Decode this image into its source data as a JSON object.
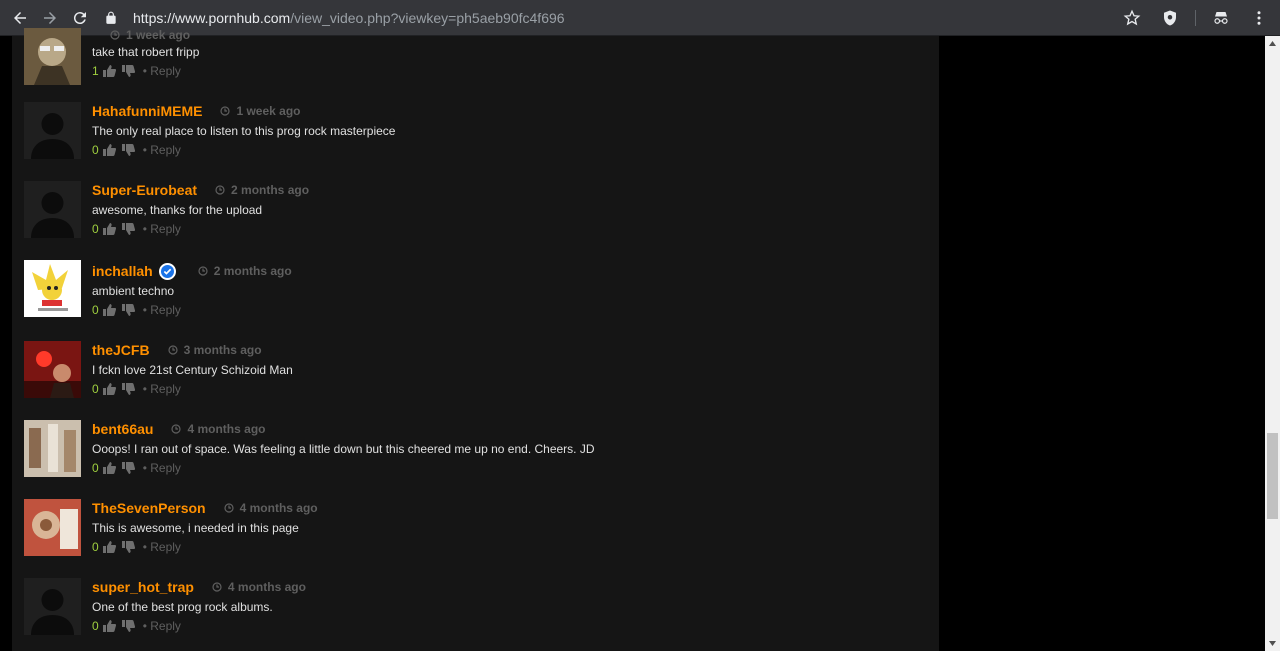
{
  "browser": {
    "url_host": "https://www.pornhub.com",
    "url_path": "/view_video.php?viewkey=ph5aeb90fc4f696"
  },
  "comments": [
    {
      "username": "",
      "time": "1 week ago",
      "text": "take that robert fripp",
      "votes": "1",
      "reply": "• Reply"
    },
    {
      "username": "HahafunniMEME",
      "time": "1 week ago",
      "text": "The only real place to listen to this prog rock masterpiece",
      "votes": "0",
      "reply": "• Reply"
    },
    {
      "username": "Super-Eurobeat",
      "time": "2 months ago",
      "text": "awesome, thanks for the upload",
      "votes": "0",
      "reply": "• Reply"
    },
    {
      "username": "inchallah",
      "time": "2 months ago",
      "text": "ambient techno",
      "votes": "0",
      "reply": "• Reply"
    },
    {
      "username": "theJCFB",
      "time": "3 months ago",
      "text": "I fckn love 21st Century Schizoid Man",
      "votes": "0",
      "reply": "• Reply"
    },
    {
      "username": "bent66au",
      "time": "4 months ago",
      "text": "Ooops! I ran out of space. Was feeling a little down but this cheered me up no end. Cheers. JD",
      "votes": "0",
      "reply": "• Reply"
    },
    {
      "username": "TheSevenPerson",
      "time": "4 months ago",
      "text": "This is awesome, i needed in this page",
      "votes": "0",
      "reply": "• Reply"
    },
    {
      "username": "super_hot_trap",
      "time": "4 months ago",
      "text": "One of the best prog rock albums.",
      "votes": "0",
      "reply": "• Reply"
    }
  ],
  "colors": {
    "username": "#ff9000",
    "votes": "#9fcf3f",
    "muted": "#5f5f5f"
  }
}
